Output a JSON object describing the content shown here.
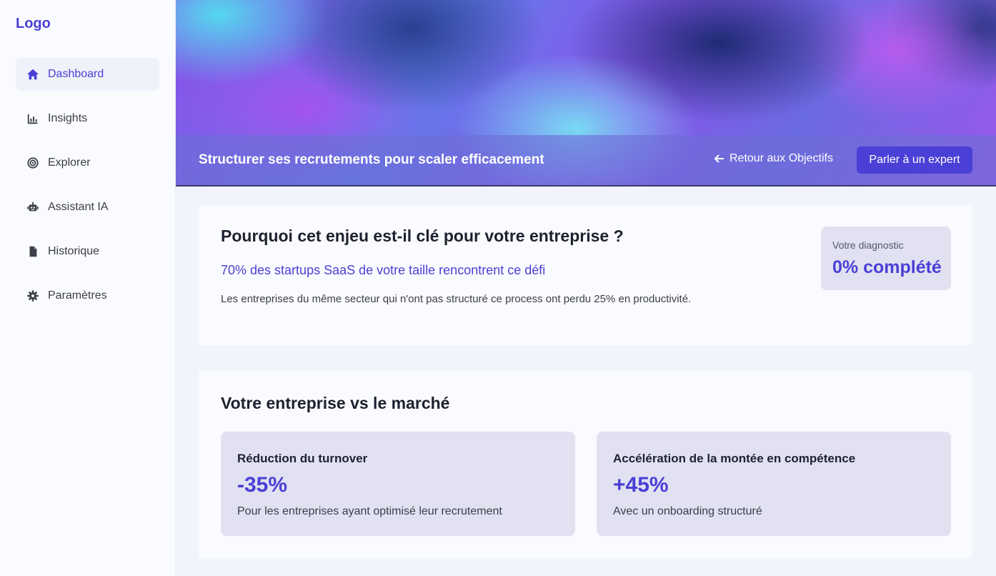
{
  "app": {
    "logo": "Logo"
  },
  "sidebar": {
    "items": [
      {
        "label": "Dashboard",
        "icon": "home-icon",
        "active": true
      },
      {
        "label": "Insights",
        "icon": "bar-chart-icon"
      },
      {
        "label": "Explorer",
        "icon": "target-icon"
      },
      {
        "label": "Assistant IA",
        "icon": "robot-icon"
      },
      {
        "label": "Historique",
        "icon": "document-icon"
      },
      {
        "label": "Paramètres",
        "icon": "gear-icon"
      }
    ]
  },
  "hero": {
    "title": "Structurer ses recrutements pour scaler efficacement",
    "back_label": "Retour aux Objectifs",
    "cta_label": "Parler à un expert"
  },
  "why": {
    "title": "Pourquoi cet enjeu est-il clé pour votre entreprise ?",
    "stat": "70% des startups SaaS de votre taille rencontrent ce défi",
    "description": "Les entreprises du même secteur qui n'ont pas structuré ce process ont perdu 25% en productivité.",
    "diagnostic": {
      "label": "Votre diagnostic",
      "value": "0% complété"
    }
  },
  "market": {
    "title": "Votre entreprise vs le marché",
    "metrics": [
      {
        "title": "Réduction du turnover",
        "value": "-35%",
        "description": "Pour les entreprises ayant optimisé leur recrutement"
      },
      {
        "title": "Accélération de la montée en compétence",
        "value": "+45%",
        "description": "Avec un onboarding structuré"
      }
    ]
  },
  "colors": {
    "accent": "#4a3fd6",
    "card_bg": "#e1e1f1",
    "page_bg": "#f1f4fb"
  }
}
